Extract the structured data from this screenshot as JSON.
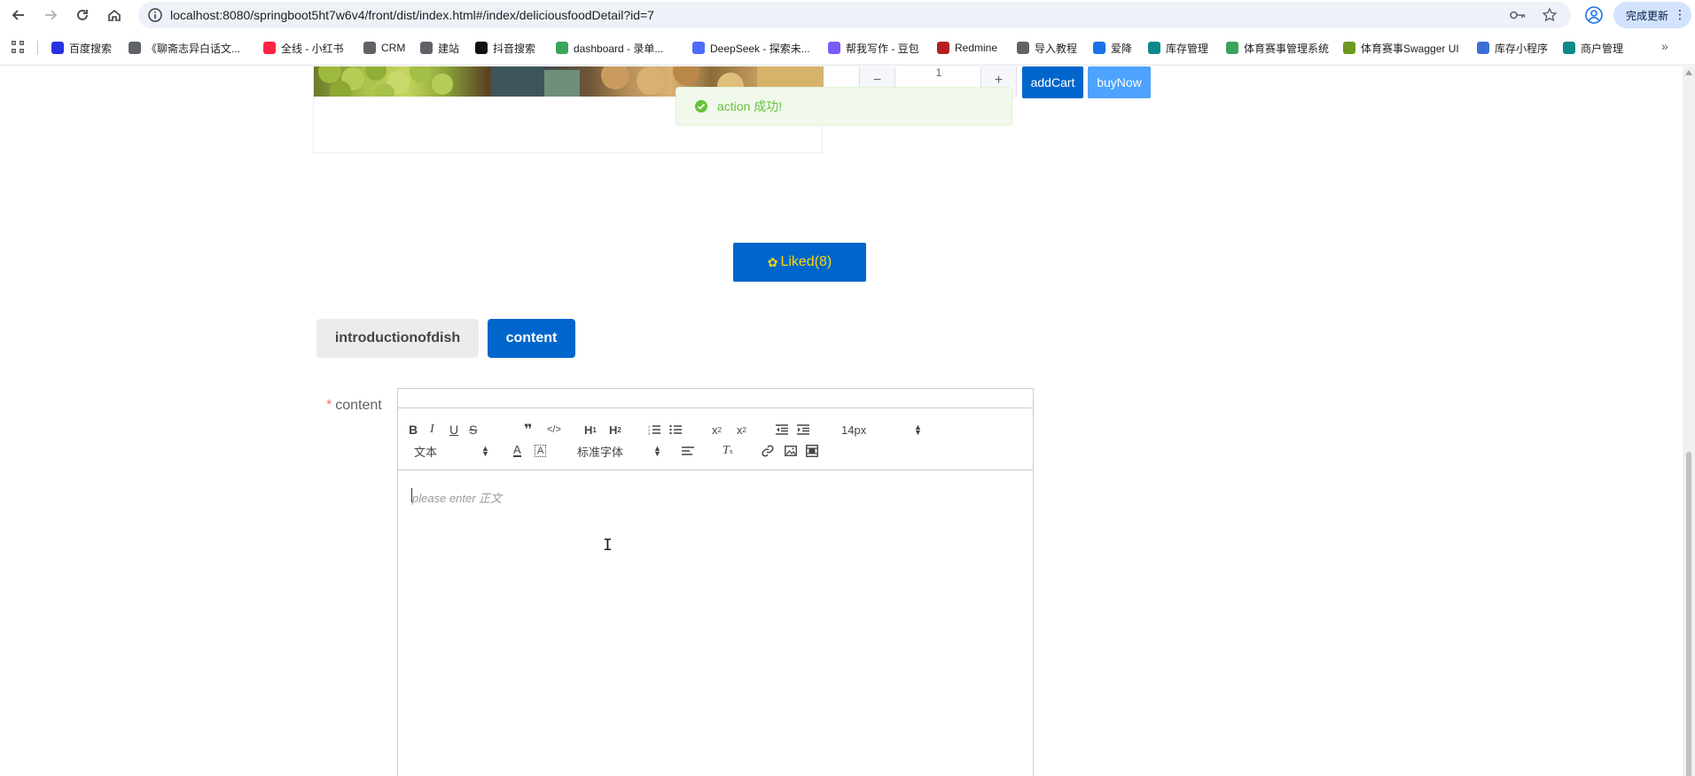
{
  "browser": {
    "url": "localhost:8080/springboot5ht7w6v4/front/dist/index.html#/index/deliciousfoodDetail?id=7",
    "update_label": "完成更新",
    "bookmarks": [
      {
        "label": "百度搜索",
        "color": "#2932e1"
      },
      {
        "label": "《聊斋志异白话文...",
        "color": "#5f6368"
      },
      {
        "label": "全线 - 小红书",
        "color": "#ff2442"
      },
      {
        "label": "CRM",
        "color": "#5f6368"
      },
      {
        "label": "建站",
        "color": "#5f6368"
      },
      {
        "label": "抖音搜索",
        "color": "#111111"
      },
      {
        "label": "dashboard - 录单...",
        "color": "#3ba55c"
      },
      {
        "label": "DeepSeek - 探索未...",
        "color": "#4d6bfe"
      },
      {
        "label": "帮我写作 - 豆包",
        "color": "#7a5af8"
      },
      {
        "label": "Redmine",
        "color": "#b32024"
      },
      {
        "label": "导入教程",
        "color": "#5f6368"
      },
      {
        "label": "爱降",
        "color": "#1a73e8"
      },
      {
        "label": "库存管理",
        "color": "#0b8a8a"
      },
      {
        "label": "体育赛事管理系统",
        "color": "#3ba55c"
      },
      {
        "label": "体育赛事Swagger UI",
        "color": "#6a9a1f"
      },
      {
        "label": "库存小程序",
        "color": "#3b6fd8"
      },
      {
        "label": "商户管理",
        "color": "#0b8a8a"
      }
    ]
  },
  "product": {
    "quantity": "1",
    "add_cart_label": "addCart",
    "buy_now_label": "buyNow"
  },
  "toast": {
    "message": "action 成功!",
    "color": "#67c23a"
  },
  "liked_button": {
    "label": "Liked(8)"
  },
  "tabs": [
    {
      "label": "introductionofdish",
      "active": false
    },
    {
      "label": "content",
      "active": true
    }
  ],
  "form": {
    "required_mark": "*",
    "content_label": "content",
    "editor": {
      "header_select": "文本",
      "font_select": "标准字体",
      "size_select": "14px",
      "placeholder": "please enter 正文"
    }
  },
  "colors": {
    "primary": "#0066cc",
    "secondary": "#4da3ff",
    "liked_text": "#ffd700"
  }
}
